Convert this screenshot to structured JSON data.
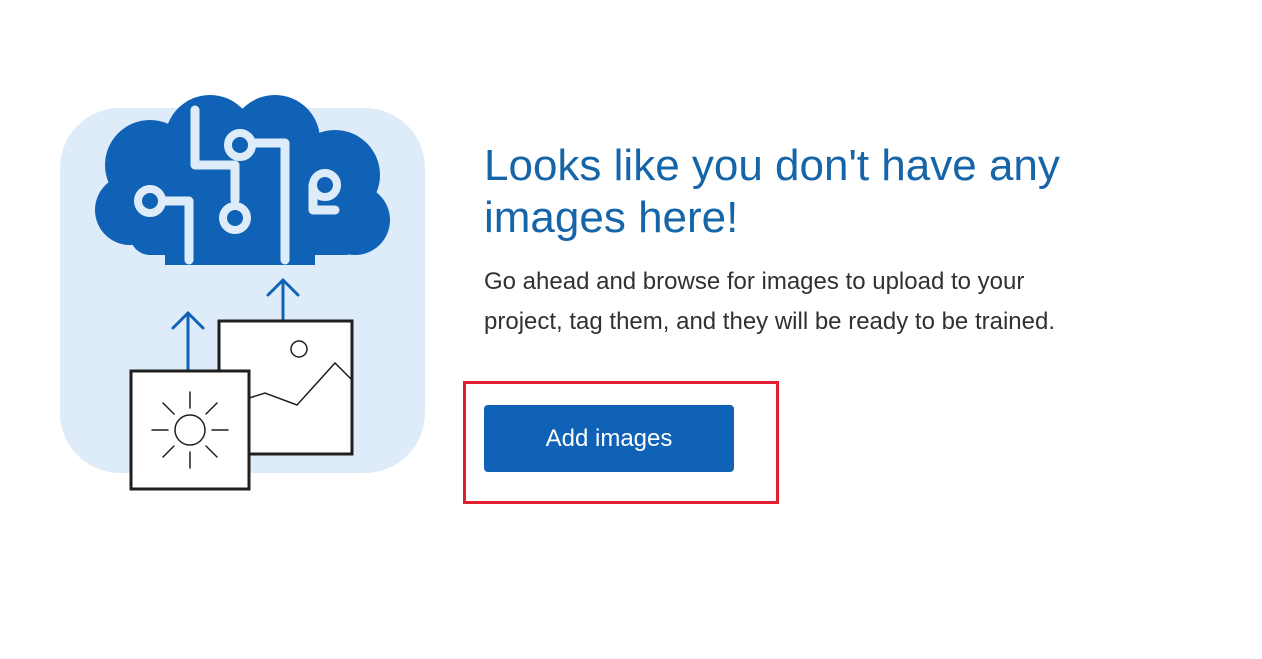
{
  "empty_state": {
    "heading": "Looks like you don't have any images here!",
    "description": "Go ahead and browse for images to upload to your project, tag them, and they will be ready to be trained.",
    "add_button_label": "Add images",
    "illustration_icon": "brain-circuit-upload-images-icon"
  },
  "colors": {
    "accent": "#0f62b5",
    "heading": "#1565a8",
    "illustration_bg": "#deecf9",
    "highlight": "#e01e2e"
  }
}
